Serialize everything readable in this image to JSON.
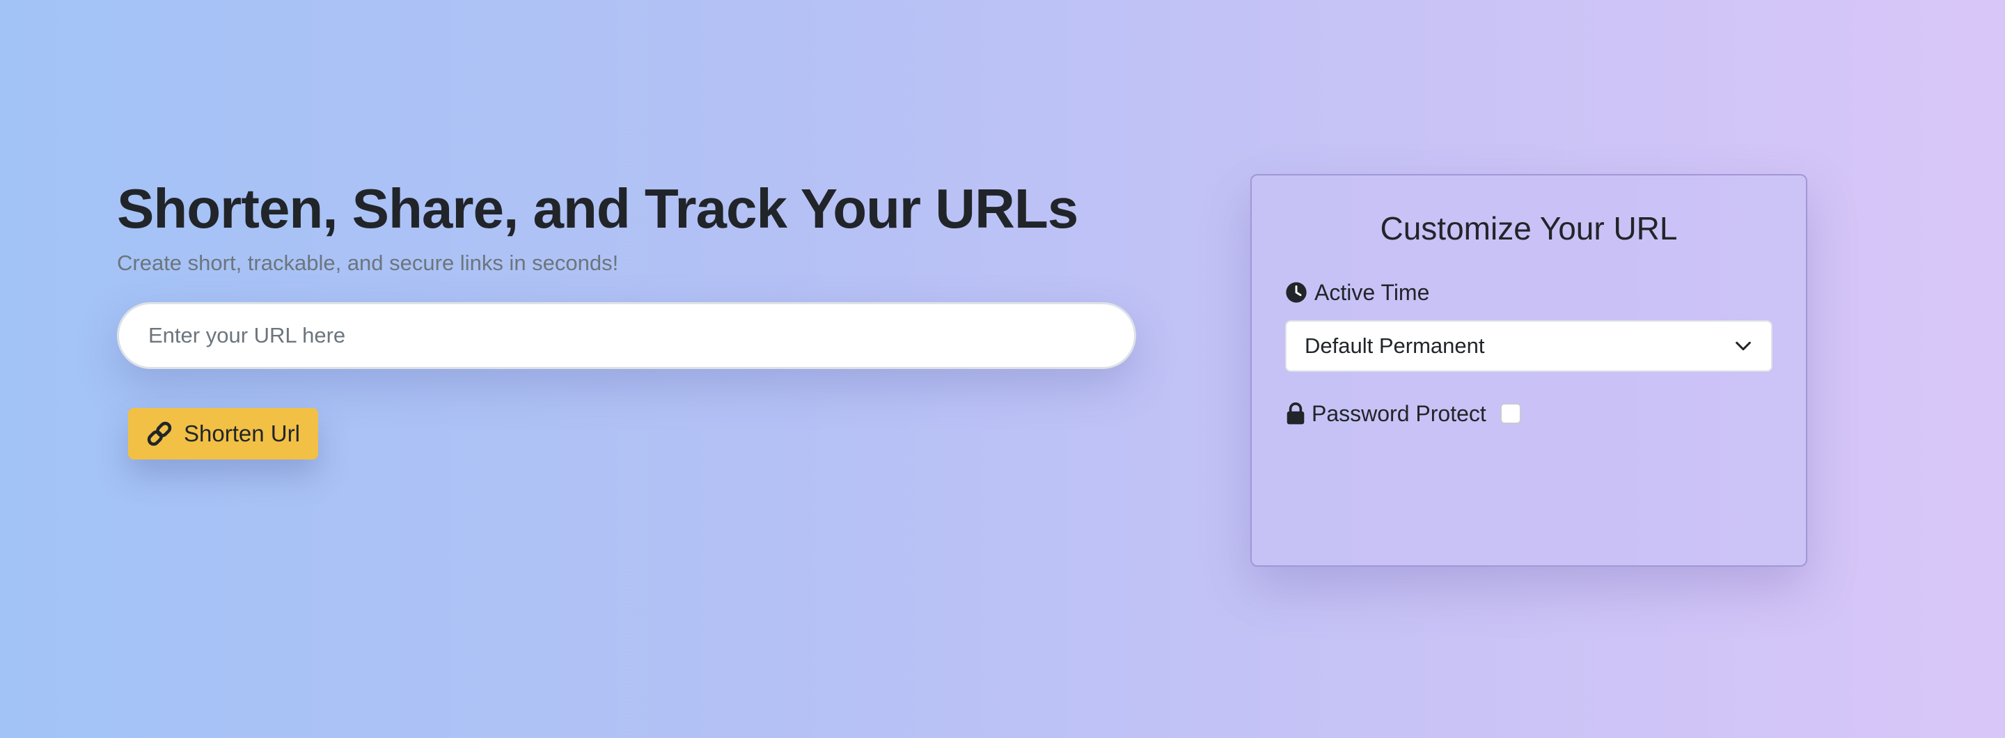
{
  "hero": {
    "title": "Shorten, Share, and Track Your URLs",
    "subtitle": "Create short, trackable, and secure links in seconds!",
    "url_input": {
      "placeholder": "Enter your URL here",
      "value": ""
    },
    "shorten_button": {
      "label": "Shorten Url",
      "icon": "link-icon",
      "color": "#f1c045"
    }
  },
  "customize_panel": {
    "title": "Customize Your URL",
    "active_time": {
      "label": "Active Time",
      "icon": "clock-icon",
      "selected": "Default Permanent"
    },
    "password_protect": {
      "label": "Password Protect",
      "icon": "lock-icon",
      "checked": false
    }
  }
}
